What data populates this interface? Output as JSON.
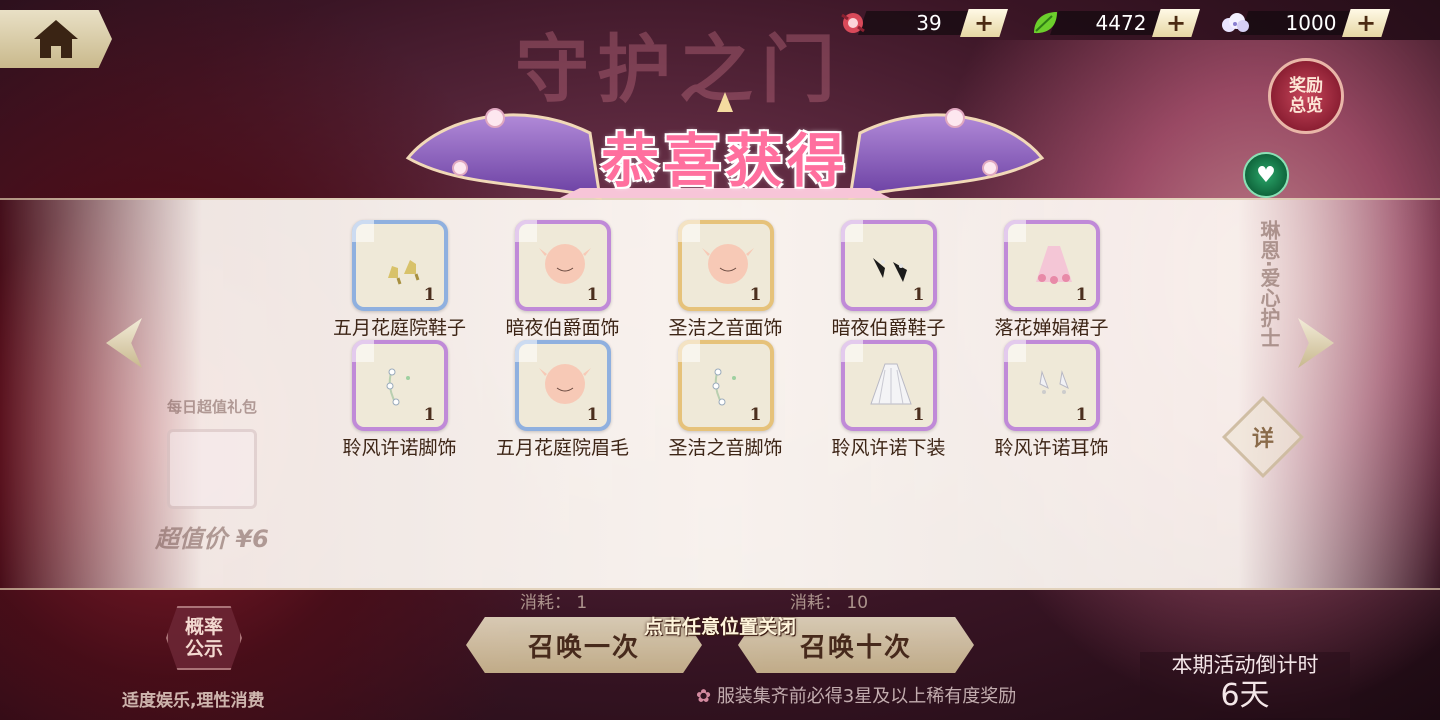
{
  "header": {
    "home_icon": "home-icon",
    "currencies": [
      {
        "icon": "candy-icon",
        "value": "39",
        "plus": "+"
      },
      {
        "icon": "leaf-icon",
        "value": "4472",
        "plus": "+"
      },
      {
        "icon": "cloud-icon",
        "value": "1000",
        "plus": "+"
      }
    ]
  },
  "background_title": "守护之门",
  "reward_overview": {
    "line1": "奖励",
    "line2": "总览"
  },
  "banner": {
    "title": "恭喜获得"
  },
  "side": {
    "character_label": "琳恩·爱心护士",
    "detail_label": "详",
    "daily_pack_label": "每日超值礼包",
    "daily_pack_price": "超值价 ¥6"
  },
  "items": [
    {
      "name": "五月花庭院鞋子",
      "qty": "1",
      "frame": "blue",
      "kind": "shoes-yellow"
    },
    {
      "name": "暗夜伯爵面饰",
      "qty": "1",
      "frame": "purple",
      "kind": "face"
    },
    {
      "name": "圣洁之音面饰",
      "qty": "1",
      "frame": "gold",
      "kind": "face"
    },
    {
      "name": "暗夜伯爵鞋子",
      "qty": "1",
      "frame": "purple",
      "kind": "shoes-black"
    },
    {
      "name": "落花婵娟裙子",
      "qty": "1",
      "frame": "purple",
      "kind": "skirt-pink"
    },
    {
      "name": "聆风许诺脚饰",
      "qty": "1",
      "frame": "purple",
      "kind": "anklet"
    },
    {
      "name": "五月花庭院眉毛",
      "qty": "1",
      "frame": "blue",
      "kind": "face"
    },
    {
      "name": "圣洁之音脚饰",
      "qty": "1",
      "frame": "gold",
      "kind": "anklet"
    },
    {
      "name": "聆风许诺下装",
      "qty": "1",
      "frame": "purple",
      "kind": "skirt-white"
    },
    {
      "name": "聆风许诺耳饰",
      "qty": "1",
      "frame": "purple",
      "kind": "earring"
    }
  ],
  "bottom": {
    "cost_one": "消耗：",
    "cost_one_value": "1",
    "cost_ten": "消耗：",
    "cost_ten_value": "10",
    "close_hint": "点击任意位置关闭",
    "summon_one": "召唤一次",
    "summon_ten": "召唤十次",
    "probability": {
      "line1": "概率",
      "line2": "公示"
    },
    "moderation": "适度娱乐,理性消费",
    "footer_note": "服装集齐前必得3星及以上稀有度奖励",
    "countdown_label": "本期活动倒计时",
    "countdown_value": "6天"
  },
  "colors": {
    "frame_blue": "#8fb0df",
    "frame_purple": "#c08ad8",
    "frame_gold": "#e6c27a",
    "banner_pink": "#ff6f9e"
  }
}
